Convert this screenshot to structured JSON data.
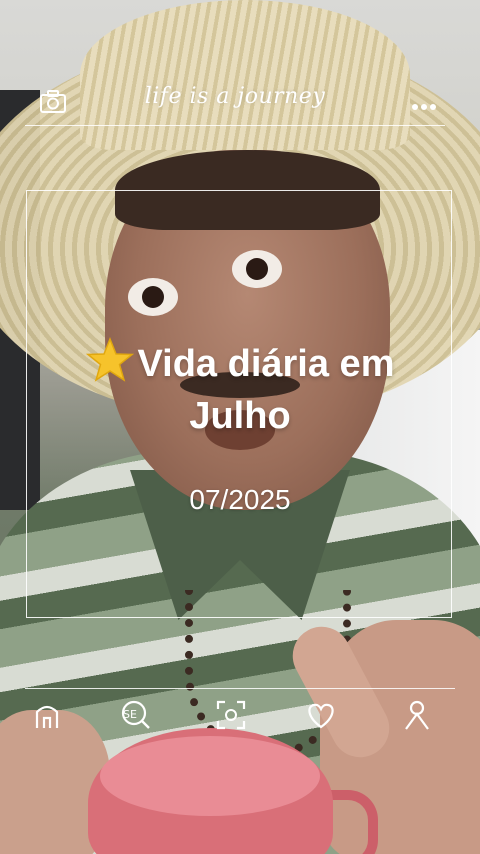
{
  "header": {
    "tagline": "life is a journey",
    "icons": [
      "camera-icon",
      "more-icon"
    ]
  },
  "card": {
    "title_line1": "Vida diária em",
    "title_line2": "Julho",
    "date": "07/2025",
    "title_icon": "star-icon"
  },
  "bottom_nav": {
    "icons": [
      "home-icon",
      "search-icon",
      "scan-icon",
      "heart-icon",
      "profile-icon"
    ]
  },
  "colors": {
    "overlay_text": "#ffffff",
    "star": "#f6c32b",
    "mug": "#d96f78"
  }
}
